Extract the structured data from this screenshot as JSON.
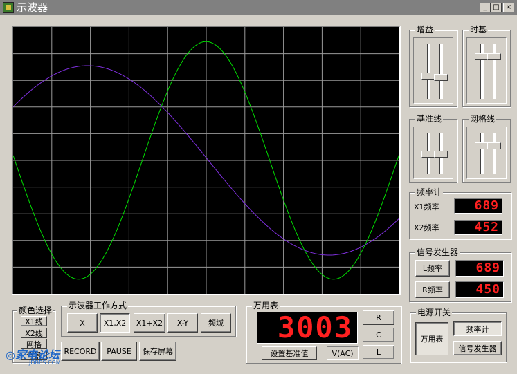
{
  "window": {
    "title": "示波器",
    "min": "_",
    "max": "□",
    "close": "×"
  },
  "scope": {
    "grid_cols": 10,
    "grid_rows": 10,
    "x1_color": "#00dd00",
    "x2_color": "#8030e0",
    "x1_wave": {
      "amplitude": 0.89,
      "period": 0.66,
      "phase": 3.1
    },
    "x2_wave": {
      "amplitude": 0.71,
      "period": 1.25,
      "phase": 0.6
    }
  },
  "gain": {
    "title": "增益",
    "levels": [
      0.58,
      0.6
    ]
  },
  "timebase": {
    "title": "时基",
    "levels": [
      0.22,
      0.22
    ]
  },
  "baseline": {
    "title": "基准线",
    "levels": [
      0.5,
      0.5
    ]
  },
  "gridline": {
    "title": "网格线",
    "levels": [
      0.3,
      0.3
    ]
  },
  "freqmeter": {
    "title": "频率计",
    "x1_label": "X1频率",
    "x1_value": "689",
    "x2_label": "X2频率",
    "x2_value": "452"
  },
  "siggen": {
    "title": "信号发生器",
    "l_label": "L频率",
    "l_value": "689",
    "r_label": "R频率",
    "r_value": "450"
  },
  "color_select": {
    "title": "颜色选择",
    "items": [
      "X1线",
      "X2线",
      "网格",
      "背景"
    ]
  },
  "mode": {
    "title": "示波器工作方式",
    "buttons": [
      "X",
      "X1,X2",
      "X1+X2",
      "X-Y",
      "频域"
    ],
    "active": 1,
    "record": "RECORD",
    "pause": "PAUSE",
    "save": "保存屏幕"
  },
  "multimeter": {
    "title": "万用表",
    "display": "3003",
    "set_baseline": "设置基准值",
    "mode": "V(AC)",
    "r": "R",
    "c": "C",
    "l": "L"
  },
  "power": {
    "title": "电源开关",
    "meter": "万用表",
    "freq": "频率计",
    "gen": "信号发生器"
  },
  "watermark": {
    "brand": "家电论坛",
    "url": "JDBBS.COM"
  }
}
